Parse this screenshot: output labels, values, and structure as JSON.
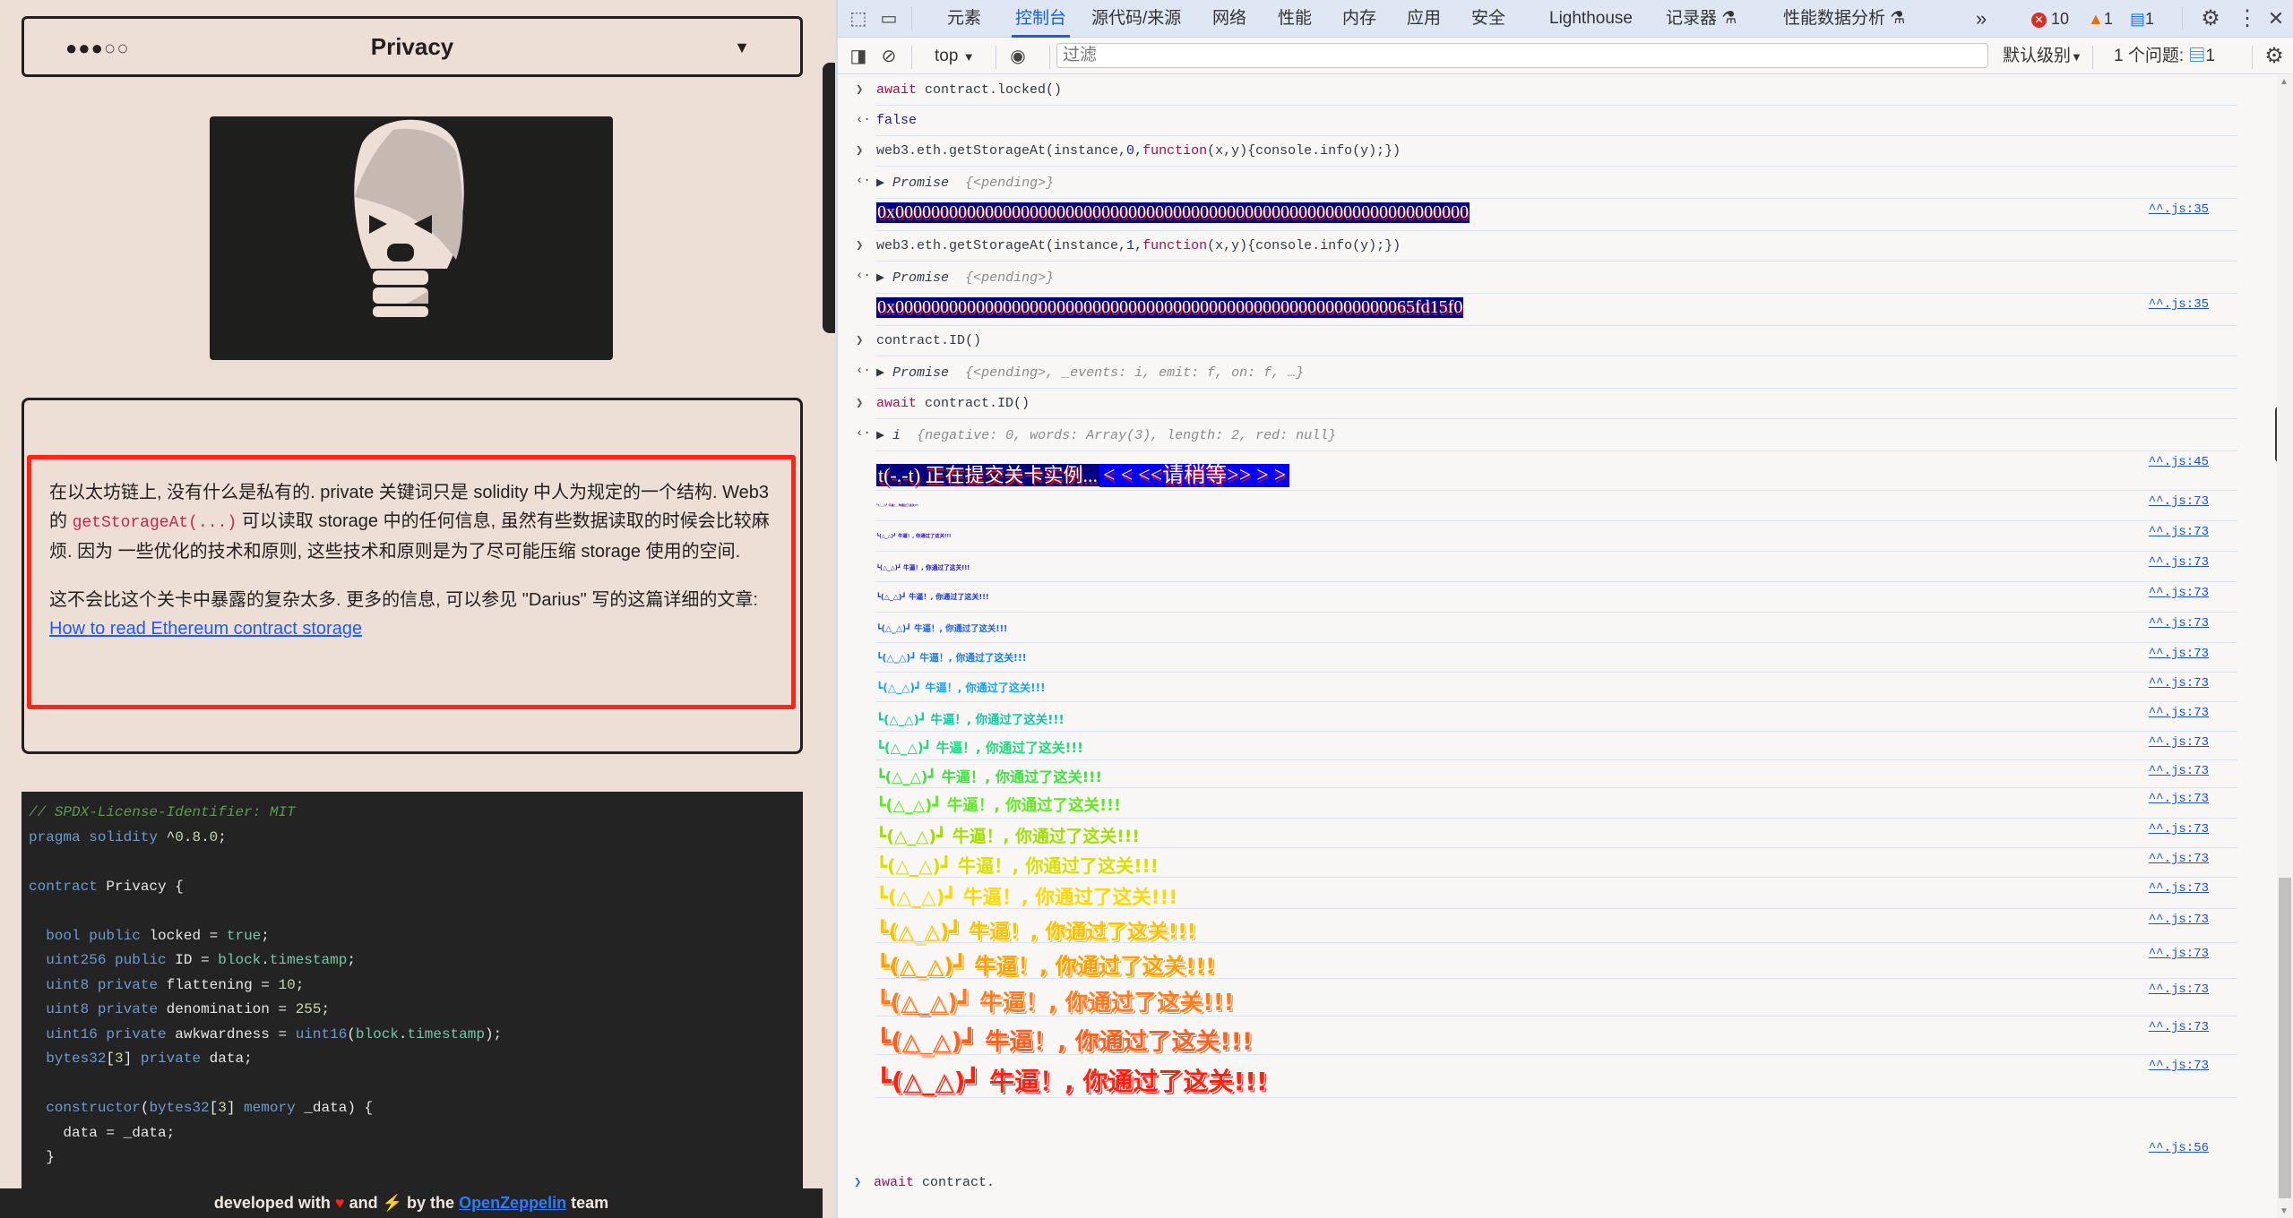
{
  "level": {
    "progress": {
      "filled": 3,
      "total": 5
    },
    "title": "Privacy",
    "caret": "▼"
  },
  "description": {
    "p1_before": "在以太坊链上, 没有什么是私有的. private 关键词只是 solidity 中人为规定的一个结构. Web3 的 ",
    "p1_code": "getStorageAt(...)",
    "p1_after": " 可以读取 storage 中的任何信息, 虽然有些数据读取的时候会比较麻烦. 因为 一些优化的技术和原则, 这些技术和原则是为了尽可能压缩 storage 使用的空间.",
    "p2_before": "这不会比这个关卡中暴露的复杂太多. 更多的信息, 可以参见 \"Darius\" 写的这篇详细的文章: ",
    "p2_link": "How to read Ethereum contract storage"
  },
  "code": {
    "lines": [
      "// SPDX-License-Identifier: MIT",
      "pragma solidity ^0.8.0;",
      "",
      "contract Privacy {",
      "",
      "  bool public locked = true;",
      "  uint256 public ID = block.timestamp;",
      "  uint8 private flattening = 10;",
      "  uint8 private denomination = 255;",
      "  uint16 private awkwardness = uint16(block.timestamp);",
      "  bytes32[3] private data;",
      "",
      "  constructor(bytes32[3] memory _data) {",
      "    data = _data;",
      "  }"
    ]
  },
  "footer": {
    "before": "developed with ",
    "heart": "♥",
    "middle": " and ",
    "bolt": "⚡",
    "after_bolt": " by the ",
    "link": "OpenZeppelin",
    "after": " team"
  },
  "devtools": {
    "tabs": [
      "元素",
      "控制台",
      "源代码/来源",
      "网络",
      "性能",
      "内存",
      "应用",
      "安全",
      "Lighthouse",
      "记录器",
      "性能数据分析"
    ],
    "active_tab": "控制台",
    "more_tabs": "»",
    "errors": "10",
    "warnings": "1",
    "infos": "1",
    "context": "top",
    "filter_placeholder": "过滤",
    "log_level": "默认级别",
    "issues_label": "1 个问题:",
    "issues_count": "1",
    "icons": {
      "inspect": "inspect-element-icon",
      "device": "device-toolbar-icon",
      "sidebar": "sidebar-toggle-icon",
      "clear": "clear-console-icon",
      "eye": "live-expression-icon",
      "settings": "gear-icon",
      "menu": "kebab-menu-icon",
      "close": "close-icon"
    }
  },
  "console": {
    "cmd_locked_await": "await",
    "cmd_locked_rest": " contract.locked()",
    "result_false": "false",
    "cmd_storage0_a": "web3.eth.getStorageAt(instance,",
    "cmd_storage0_num": "0",
    "cmd_storage_fn": "function",
    "cmd_storage_tail": "(x,y){console.info(y);})",
    "promise_label": "Promise",
    "promise_pending": "{<pending>}",
    "hex0": "0x0000000000000000000000000000000000000000000000000000000000000000",
    "src_35": "^^.js:35",
    "cmd_storage1_num": "1",
    "hex1": "0x0000000000000000000000000000000000000000000000000000000065fd15f0",
    "cmd_id": "contract.ID()",
    "promise_events": "{<pending>, _events: i, emit: f, on: f, …}",
    "cmd_id_await": "await",
    "cmd_id_rest": " contract.ID()",
    "bn_label": "i",
    "bn_value": "{negative: 0, words: Array(3), length: 2, red: null}",
    "banner_a": "t(-.-t) 正在提交关卡实例...",
    "banner_b": "< < <<请稍等>> > >",
    "src_45": "^^.js:45",
    "celebrate_text": "┗(△_△)┛  牛逼！, 你通过了这关!!!",
    "celebrate_colors": [
      "#3a0080",
      "#2600c0",
      "#1e10d8",
      "#1030f0",
      "#1a5cf0",
      "#1a7cf0",
      "#1aa0f0",
      "#10c8a0",
      "#20d880",
      "#40e040",
      "#60e820",
      "#a0e000",
      "#d8e000",
      "#ffd800",
      "#ffc000",
      "#ffa000",
      "#ff7a20",
      "#ff6020",
      "#ff2010"
    ],
    "src_73": "^^.js:73",
    "src_56": "^^.js:56",
    "prompt_await": "await",
    "prompt_rest": " contract."
  }
}
